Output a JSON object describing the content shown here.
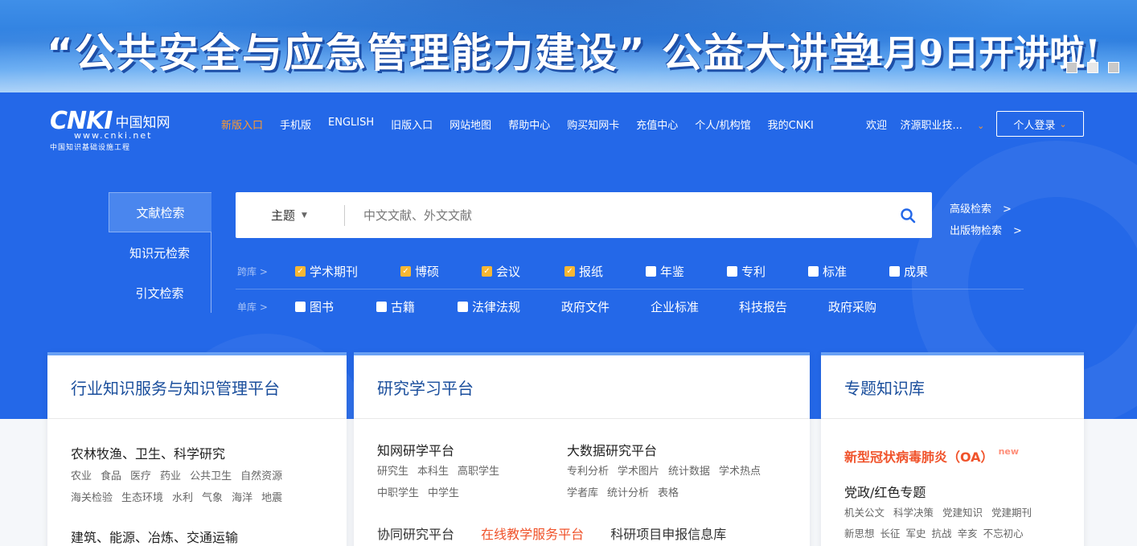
{
  "banner": {
    "title": "“公共安全与应急管理能力建设” 公益大讲堂",
    "date": "4月9日开讲啦!"
  },
  "logo": {
    "mark": "CNKI",
    "chinese": "中国知网",
    "url": "www.cnki.net",
    "subtitle": "中国知识基础设施工程"
  },
  "topnav": [
    "新版入口",
    "手机版",
    "ENGLISH",
    "旧版入口",
    "网站地图",
    "帮助中心",
    "购买知网卡",
    "充值中心",
    "个人/机构馆",
    "我的CNKI"
  ],
  "user": {
    "welcome": "欢迎",
    "org": "济源职业技...",
    "login": "个人登录"
  },
  "search": {
    "tabs": [
      "文献检索",
      "知识元检索",
      "引文检索"
    ],
    "field": "主题",
    "placeholder": "中文文献、外文文献",
    "advanced": "高级检索",
    "publication": "出版物检索"
  },
  "filters": {
    "cross_label": "跨库",
    "cross": [
      {
        "label": "学术期刊",
        "checked": true
      },
      {
        "label": "博硕",
        "checked": true
      },
      {
        "label": "会议",
        "checked": true
      },
      {
        "label": "报纸",
        "checked": true
      },
      {
        "label": "年鉴",
        "checked": false
      },
      {
        "label": "专利",
        "checked": false
      },
      {
        "label": "标准",
        "checked": false
      },
      {
        "label": "成果",
        "checked": false
      }
    ],
    "single_label": "单库",
    "single": [
      {
        "label": "图书",
        "checkbox": true
      },
      {
        "label": "古籍",
        "checkbox": true
      },
      {
        "label": "法律法规",
        "checkbox": true
      },
      {
        "label": "政府文件",
        "checkbox": false
      },
      {
        "label": "企业标准",
        "checkbox": false
      },
      {
        "label": "科技报告",
        "checkbox": false
      },
      {
        "label": "政府采购",
        "checkbox": false
      }
    ]
  },
  "card1": {
    "title": "行业知识服务与知识管理平台",
    "sec1_title": "农林牧渔、卫生、科学研究",
    "sec1_tags_a": [
      "农业",
      "食品",
      "医疗",
      "药业",
      "公共卫生",
      "自然资源"
    ],
    "sec1_tags_b": [
      "海关检验",
      "生态环境",
      "水利",
      "气象",
      "海洋",
      "地震"
    ],
    "sec2_title": "建筑、能源、冶炼、交通运输"
  },
  "card2": {
    "title": "研究学习平台",
    "col1_title": "知网研学平台",
    "col1_tags_a": [
      "研究生",
      "本科生",
      "高职学生"
    ],
    "col1_tags_b": [
      "中职学生",
      "中学生"
    ],
    "col2_title": "大数据研究平台",
    "col2_tags_a": [
      "专利分析",
      "学术图片",
      "统计数据",
      "学术热点"
    ],
    "col2_tags_b": [
      "学者库",
      "统计分析",
      "表格"
    ],
    "bottom": [
      "协同研究平台",
      "在线教学服务平台",
      "科研项目申报信息库"
    ]
  },
  "card3": {
    "title": "专题知识库",
    "featured": "新型冠状病毒肺炎（OA）",
    "featured_badge": "new",
    "sec_title": "党政/红色专题",
    "tags_a": [
      "机关公文",
      "科学决策",
      "党建知识",
      "党建期刊"
    ],
    "tags_b": [
      "新思想",
      "长征",
      "军史",
      "抗战",
      "辛亥",
      "不忘初心"
    ]
  }
}
